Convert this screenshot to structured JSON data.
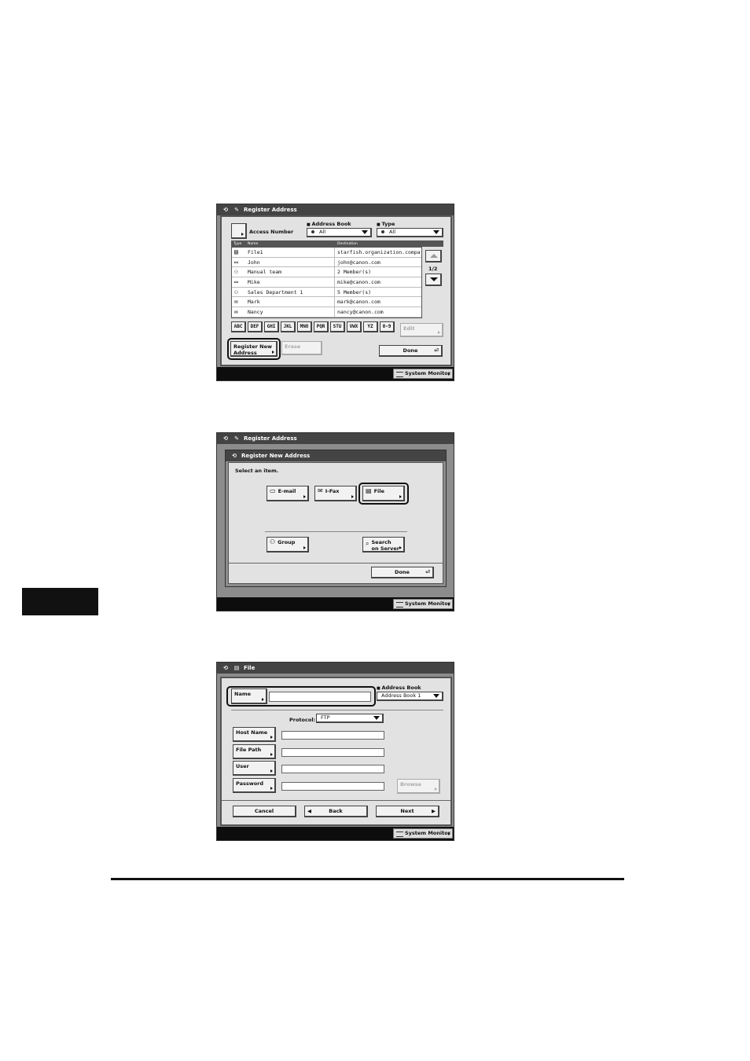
{
  "screen1": {
    "title": "Register Address",
    "access_number_label": "Access Number",
    "address_book_label": "Address Book",
    "address_book_value": "All",
    "type_label": "Type",
    "type_value": "All",
    "columns": [
      "Type",
      "Name",
      "Destination"
    ],
    "rows": [
      {
        "icon": "file-icon",
        "glyph": "▤",
        "name": "File1",
        "destination": "starfish.organization.compa"
      },
      {
        "icon": "email-icon",
        "glyph": "▭",
        "name": "John",
        "destination": "john@canon.com"
      },
      {
        "icon": "group-icon",
        "glyph": "⚇",
        "name": "Manual team",
        "destination": "2 Member(s)"
      },
      {
        "icon": "email-icon",
        "glyph": "▭",
        "name": "Mike",
        "destination": "mike@canon.com"
      },
      {
        "icon": "group-icon",
        "glyph": "⚇",
        "name": "Sales Department 1",
        "destination": "5 Member(s)"
      },
      {
        "icon": "ifax-icon",
        "glyph": "✉",
        "name": "Mark",
        "destination": "mark@canon.com"
      },
      {
        "icon": "ifax-icon",
        "glyph": "✉",
        "name": "Nancy",
        "destination": "nancy@canon.com"
      }
    ],
    "page_indicator": "1/2",
    "keys": [
      "ABC",
      "DEF",
      "GHI",
      "JKL",
      "MNO",
      "PQR",
      "STU",
      "VWX",
      "YZ",
      "0-9"
    ],
    "edit_label": "Edit",
    "register_label_1": "Register New",
    "register_label_2": "Address",
    "erase_label": "Erase",
    "done_label": "Done",
    "system_monitor": "System Monitor"
  },
  "screen2": {
    "title": "Register Address",
    "subtitle": "Register New Address",
    "instruction": "Select an item.",
    "email_label": "E-mail",
    "ifax_label": "I-Fax",
    "file_label": "File",
    "group_label": "Group",
    "search_label_1": "Search",
    "search_label_2": "on Server",
    "done_label": "Done",
    "system_monitor": "System Monitor"
  },
  "screen3": {
    "title": "File",
    "name_label": "Name",
    "address_book_label": "Address Book",
    "address_book_value": "Address Book 1",
    "protocol_label": "Protocol:",
    "protocol_value": "FTP",
    "host_name_label": "Host Name",
    "file_path_label": "File Path",
    "user_label": "User",
    "password_label": "Password",
    "browse_label": "Browse",
    "cancel_label": "Cancel",
    "back_label": "Back",
    "next_label": "Next",
    "system_monitor": "System Monitor"
  }
}
